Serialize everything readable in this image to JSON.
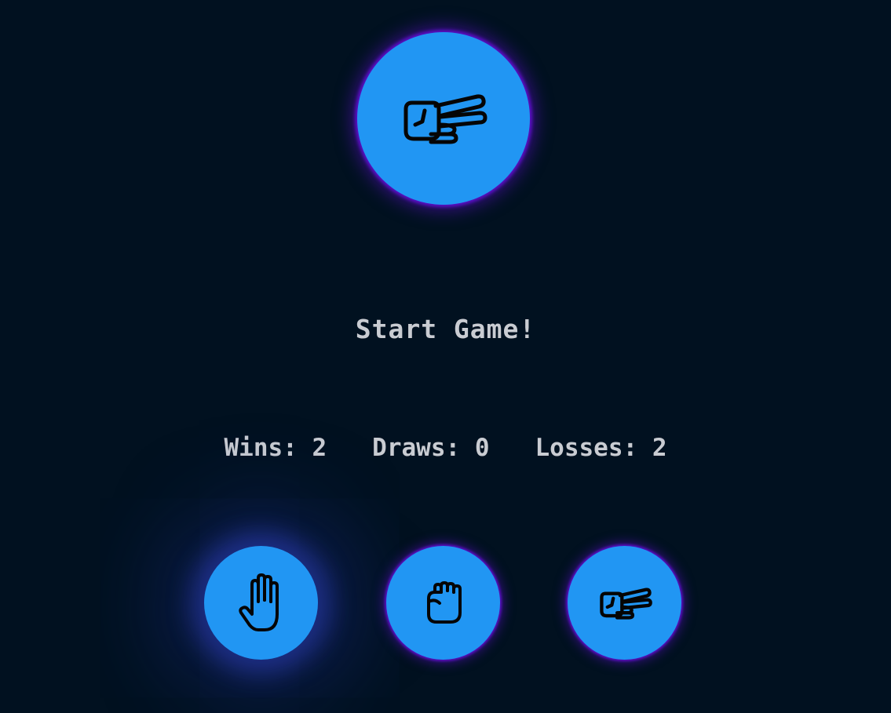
{
  "computer_choice": {
    "icon": "scissors-hand-icon",
    "circle_color": "#2196f3",
    "glow_color": "#5b0fc7"
  },
  "status_text": "Start Game!",
  "score": {
    "wins_label": "Wins:",
    "wins": "2",
    "draws_label": "Draws:",
    "draws": "0",
    "losses_label": "Losses:",
    "losses": "2"
  },
  "choices": [
    {
      "id": "paper",
      "icon": "paper-hand-icon"
    },
    {
      "id": "rock",
      "icon": "rock-fist-icon"
    },
    {
      "id": "scissors",
      "icon": "scissors-hand-icon"
    }
  ],
  "colors": {
    "background": "#011120",
    "text": "#c9ccd2",
    "button": "#2196f3",
    "hover_glow": "#3548d2"
  }
}
